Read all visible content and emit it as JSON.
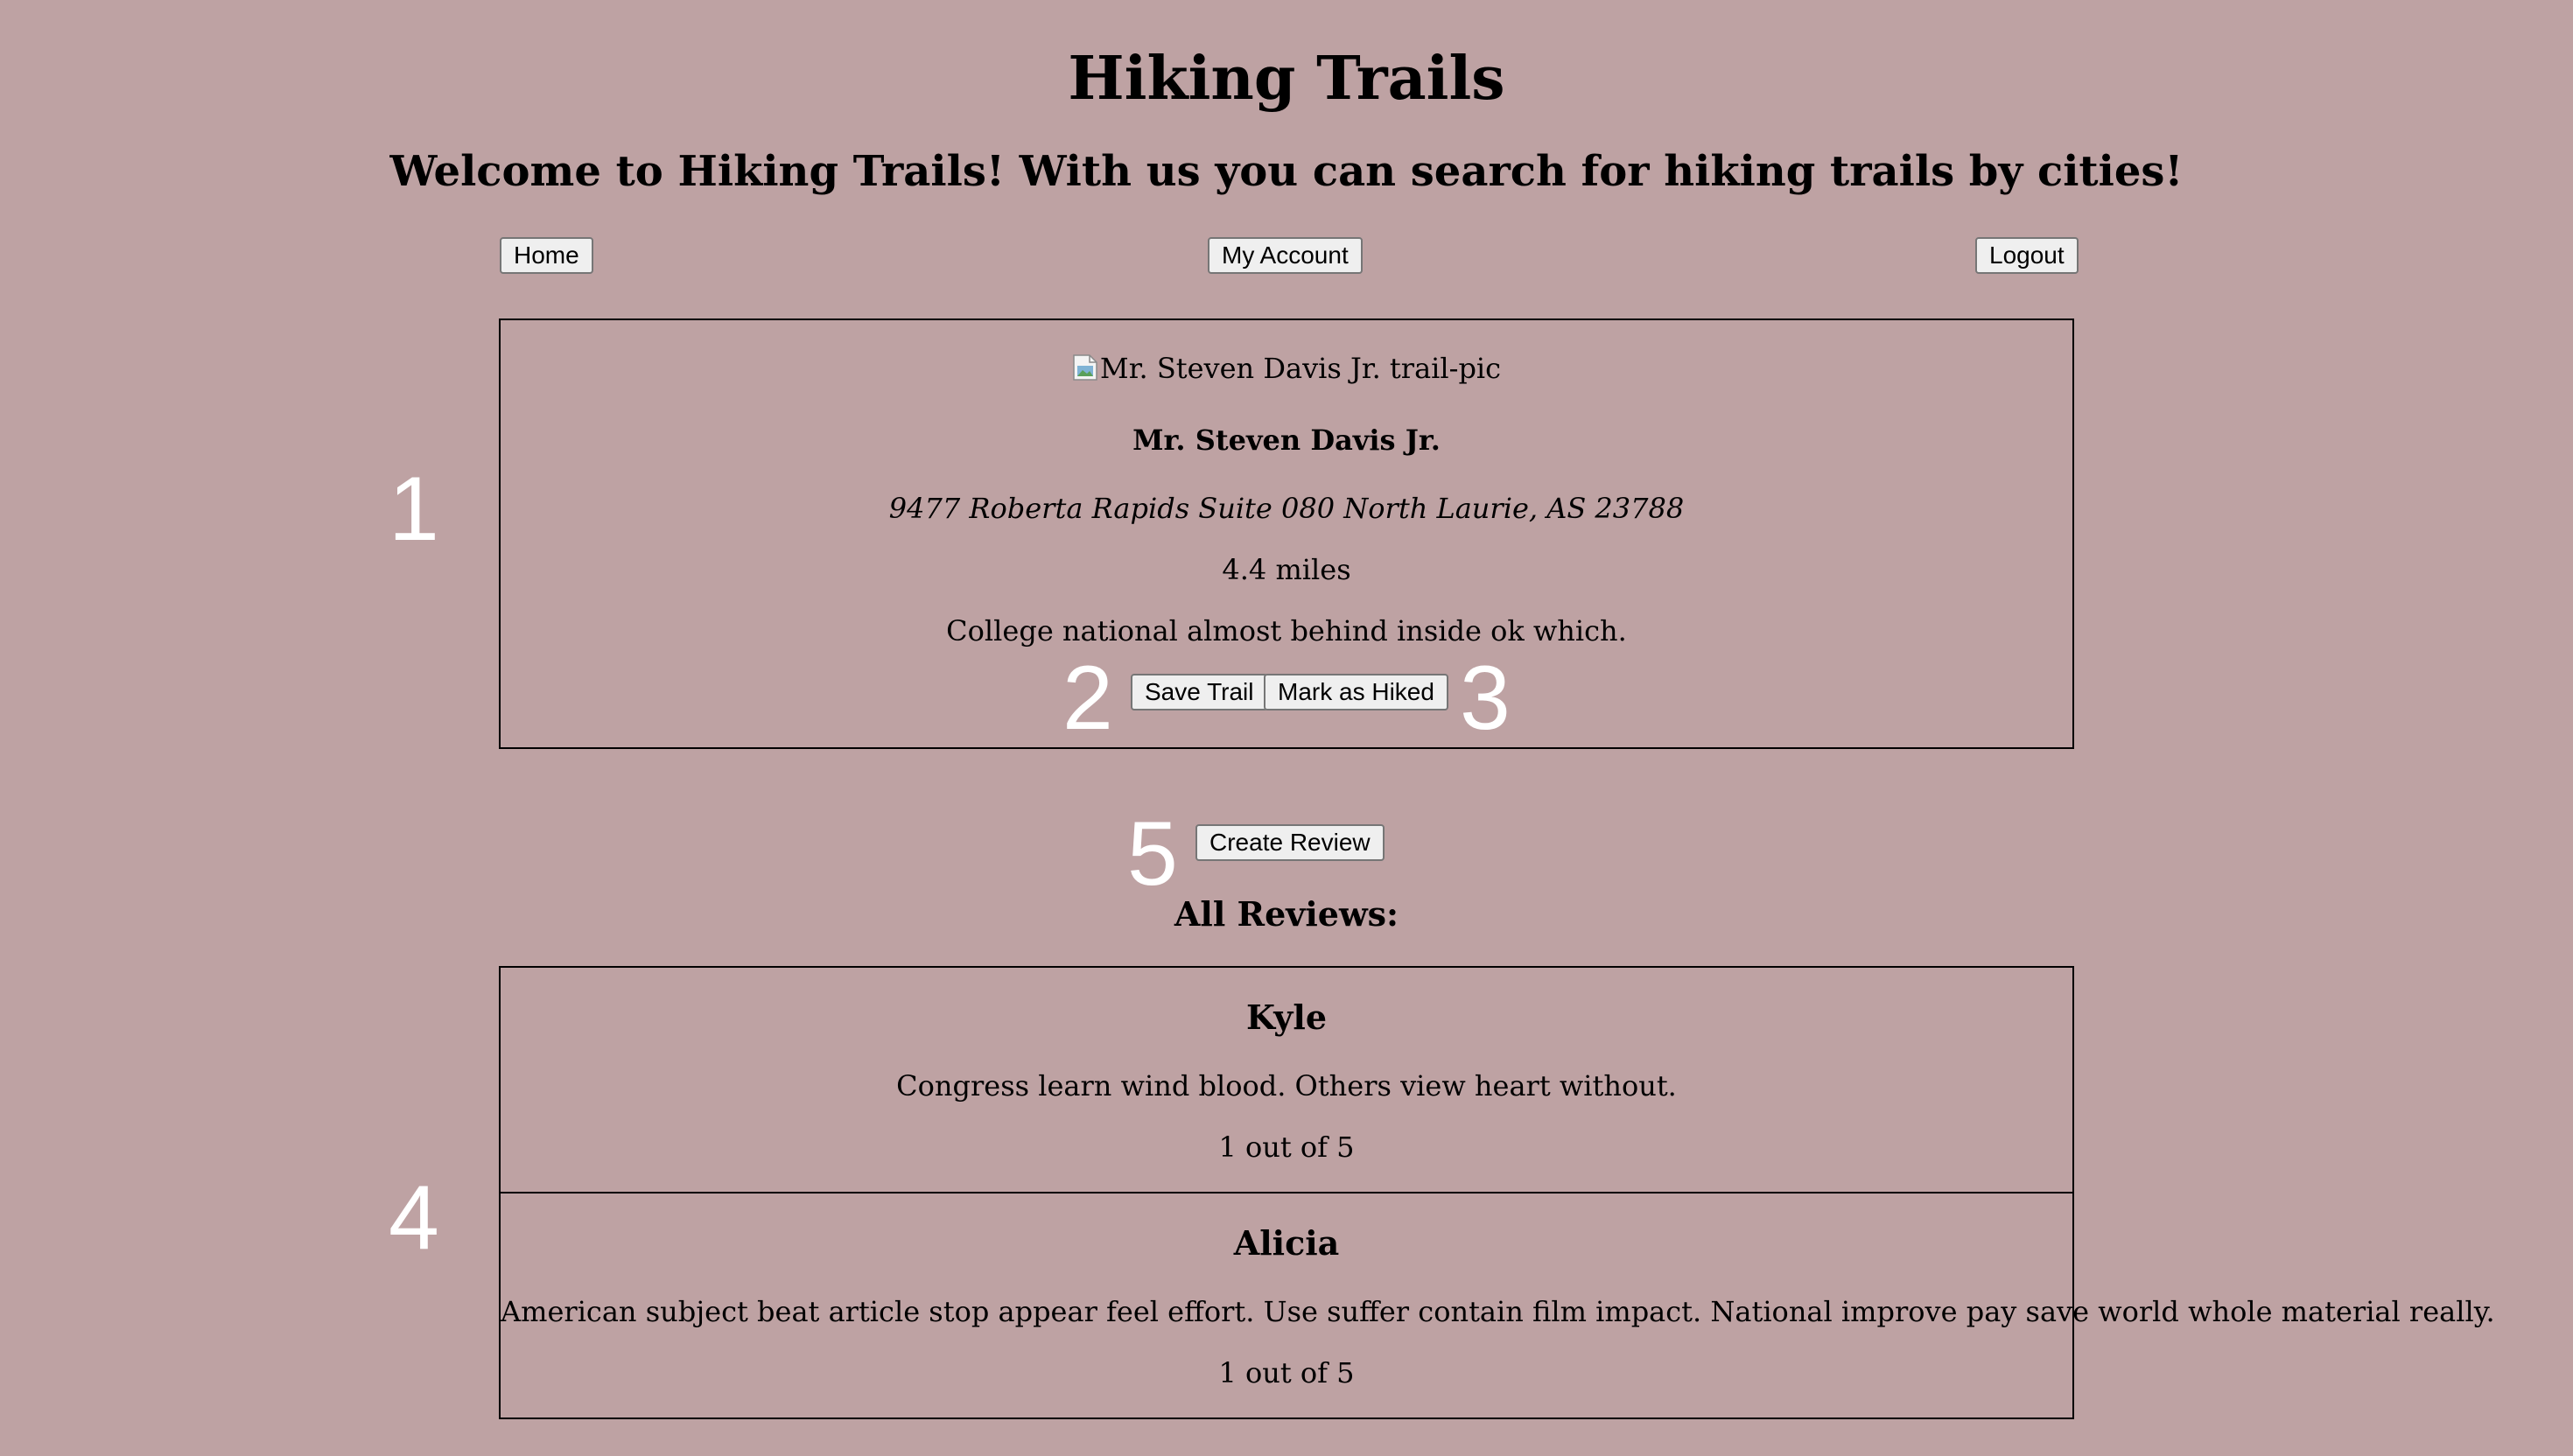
{
  "header": {
    "title": "Hiking Trails",
    "welcome": "Welcome to Hiking Trails! With us you can search for hiking trails by cities!"
  },
  "nav": {
    "home_label": "Home",
    "account_label": "My Account",
    "logout_label": "Logout"
  },
  "trail": {
    "image_alt": "Mr. Steven Davis Jr. trail-pic",
    "name": "Mr. Steven Davis Jr.",
    "address": "9477 Roberta Rapids Suite 080 North Laurie, AS 23788",
    "distance": "4.4 miles",
    "description": "College national almost behind inside ok which.",
    "save_label": "Save Trail",
    "hiked_label": "Mark as Hiked"
  },
  "markers": {
    "one": "1",
    "two": "2",
    "three": "3",
    "four": "4",
    "five": "5"
  },
  "reviews": {
    "create_label": "Create Review",
    "heading": "All Reviews:",
    "items": [
      {
        "author": "Kyle",
        "text": "Congress learn wind blood. Others view heart without.",
        "rating": "1 out of 5"
      },
      {
        "author": "Alicia",
        "text": "American subject beat article stop appear feel effort. Use suffer contain film impact. National improve pay save world whole material really.",
        "rating": "1 out of 5"
      }
    ]
  }
}
